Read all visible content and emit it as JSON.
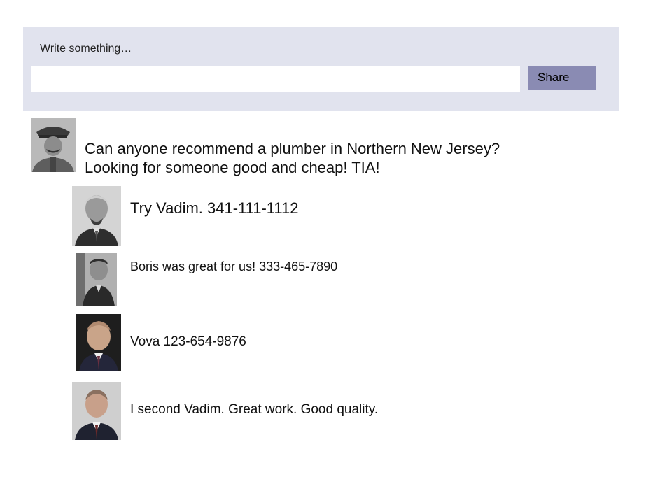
{
  "composer": {
    "prompt": "Write something…",
    "input_value": "",
    "share_label": "Share"
  },
  "post": {
    "text": "Can anyone recommend a plumber in Northern New Jersey? Looking for someone good and cheap! TIA!",
    "avatar_icon": "person-portrait-icon"
  },
  "replies": [
    {
      "text": "Try Vadim.  341-111-1112",
      "avatar_icon": "person-portrait-icon"
    },
    {
      "text": "Boris was great for us! 333-465-7890",
      "avatar_icon": "person-portrait-icon"
    },
    {
      "text": "Vova  123-654-9876",
      "avatar_icon": "person-portrait-icon"
    },
    {
      "text": "I second Vadim. Great work. Good quality.",
      "avatar_icon": "person-portrait-icon"
    }
  ],
  "colors": {
    "composer_background": "#e1e3ee",
    "share_button": "#8a8bb3"
  }
}
